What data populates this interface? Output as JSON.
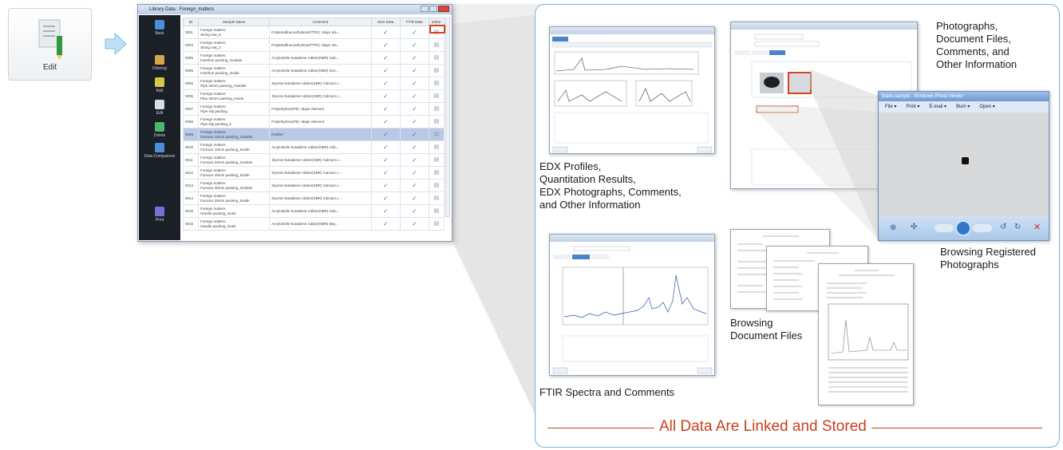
{
  "edit_tile": {
    "label": "Edit"
  },
  "app_window": {
    "title": "Library Data : Foreign_matters",
    "sidebar": [
      {
        "label": "Back",
        "icon": "back-icon",
        "color": "#4a8fd8"
      },
      {
        "label": "Filtering",
        "icon": "filter-icon",
        "color": "#d8a64a"
      },
      {
        "label": "Add",
        "icon": "add-icon",
        "color": "#d8c84a"
      },
      {
        "label": "Edit",
        "icon": "edit-icon",
        "color": "#d8dde3"
      },
      {
        "label": "Delete",
        "icon": "trash-icon",
        "color": "#4ab86a"
      },
      {
        "label": "Data Comparison",
        "icon": "compare-icon",
        "color": "#4a8fd8"
      },
      {
        "label": "Print",
        "icon": "print-icon",
        "color": "#7a6fd8"
      }
    ],
    "columns": [
      "ID",
      "Sample Name",
      "Comment",
      "EDX Data",
      "FTIR Data",
      "Editor"
    ],
    "rows": [
      {
        "id": "0001",
        "name": "Foreign matters\nString mat_H",
        "comment": "Polytetrafluoroethylene(PTFE)  Major ele...",
        "selected": false
      },
      {
        "id": "0003",
        "name": "Foreign matters\nString mat_2",
        "comment": "Polytetrafluoroethylene(PTFE)  Major ele...",
        "selected": false
      },
      {
        "id": "0005",
        "name": "Foreign matters\nInsertion packing_Outside",
        "comment": "Acrylonitrile butadiene rubber(NBR) Calc...",
        "selected": false
      },
      {
        "id": "0006",
        "name": "Foreign matters\nInsertion packing_Inside",
        "comment": "Acrylonitrile butadiene rubber(NBR) Iron...",
        "selected": false
      },
      {
        "id": "0005",
        "name": "Foreign matters\nPipe 30mm packing_Outside",
        "comment": "Styrene butadiene rubber(SBR) Calcium c...",
        "selected": false
      },
      {
        "id": "0006",
        "name": "Foreign matters\nPipe 30mm packing_Inside",
        "comment": "Styrene butadiene rubber(SBR) Calcium c...",
        "selected": false
      },
      {
        "id": "0007",
        "name": "Foreign matters\nPipe slip packing",
        "comment": "Polyethylene(PE)  Major element",
        "selected": false
      },
      {
        "id": "0008",
        "name": "Foreign matters\nPipe slip packing_2",
        "comment": "Polyethylene(PE)  Major element",
        "selected": false
      },
      {
        "id": "0009",
        "name": "Foreign matters\nFurnace 10mm packing_Outside",
        "comment": "Rubber",
        "selected": true
      },
      {
        "id": "0010",
        "name": "Foreign matters\nFurnace 10mm packing_Inside",
        "comment": "Acrylonitrile butadiene rubber(NBR) Calc...",
        "selected": false
      },
      {
        "id": "0011",
        "name": "Foreign matters\nFurnace 20mm packing_Outside",
        "comment": "Styrene butadiene rubber(SBR) Calcium c...",
        "selected": false
      },
      {
        "id": "0012",
        "name": "Foreign matters\nFurnace 20mm packing_Inside",
        "comment": "Styrene butadiene rubber(SBR) Calcium c...",
        "selected": false
      },
      {
        "id": "0013",
        "name": "Foreign matters\nFurnace 30mm packing_Outside",
        "comment": "Styrene butadiene rubber(SBR) Calcium c...",
        "selected": false
      },
      {
        "id": "0014",
        "name": "Foreign matters\nFurnace 30mm packing_Inside",
        "comment": "Styrene butadiene rubber(SBR) Calcium c...",
        "selected": false
      },
      {
        "id": "0015",
        "name": "Foreign matters\nHandle packing_Outer",
        "comment": "Acrylonitrile butadiene rubber(NBR) Calc...",
        "selected": false
      },
      {
        "id": "0016",
        "name": "Foreign matters\nHandle packing_Outer",
        "comment": "Acrylonitrile butadiene rubber(NBR) Maj...",
        "selected": false
      }
    ]
  },
  "captions": {
    "edx": "EDX Profiles,\nQuantitation Results,\nEDX Photographs, Comments,\nand Other Information",
    "photos": "Photographs,\nDocument Files,\nComments, and\nOther Information",
    "browse_photos": "Browsing Registered\nPhotographs",
    "browse_docs": "Browsing\nDocument Files",
    "ftir": "FTIR Spectra and Comments"
  },
  "photo_viewer": {
    "title": "black-sample - Windows Photo Viewer",
    "menu": [
      "File",
      "Print",
      "E-mail",
      "Burn",
      "Open"
    ]
  },
  "footer": "All Data Are Linked and Stored",
  "colors": {
    "accent": "#c8401c",
    "panel_border": "#6fb4d8",
    "highlight": "#d9421c"
  }
}
